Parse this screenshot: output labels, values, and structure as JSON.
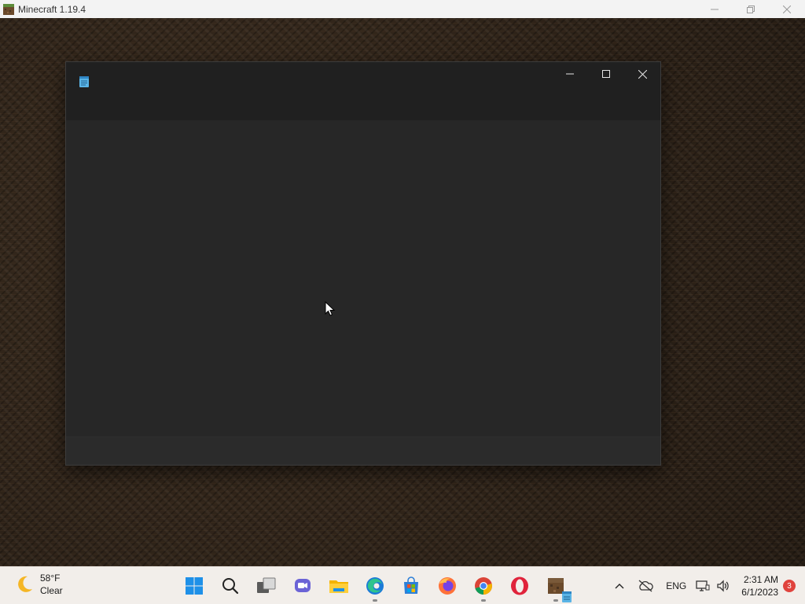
{
  "minecraft_window": {
    "title": "Minecraft 1.19.4",
    "icon": "minecraft-grass-block-icon",
    "controls": [
      "minimize",
      "restore",
      "close"
    ]
  },
  "notepad_window": {
    "icon": "notepad-icon",
    "controls": [
      "minimize",
      "maximize",
      "close"
    ],
    "theme": "dark"
  },
  "taskbar": {
    "weather": {
      "icon": "moon-icon",
      "temperature": "58°F",
      "condition": "Clear"
    },
    "apps": [
      {
        "name": "start-button",
        "icon": "windows-logo-icon"
      },
      {
        "name": "search-button",
        "icon": "search-icon"
      },
      {
        "name": "task-view-button",
        "icon": "task-view-icon"
      },
      {
        "name": "teams-chat-button",
        "icon": "teams-chat-icon"
      },
      {
        "name": "file-explorer-button",
        "icon": "folder-icon"
      },
      {
        "name": "edge-button",
        "icon": "edge-icon",
        "running": true
      },
      {
        "name": "ms-store-button",
        "icon": "store-icon"
      },
      {
        "name": "firefox-button",
        "icon": "firefox-icon"
      },
      {
        "name": "chrome-button",
        "icon": "chrome-icon",
        "running": true
      },
      {
        "name": "opera-button",
        "icon": "opera-icon"
      },
      {
        "name": "minecraft-launcher-button",
        "icon": "minecraft-icon",
        "running": true
      }
    ],
    "tray": {
      "language": "ENG",
      "time": "2:31 AM",
      "date": "6/1/2023",
      "notifications": "3"
    }
  },
  "colors": {
    "notepad_bg": "#272727",
    "notepad_titlebar": "#202020",
    "taskbar_bg": "#f2eeea",
    "accent_blue": "#0078d4",
    "badge_red": "#e0433d"
  }
}
